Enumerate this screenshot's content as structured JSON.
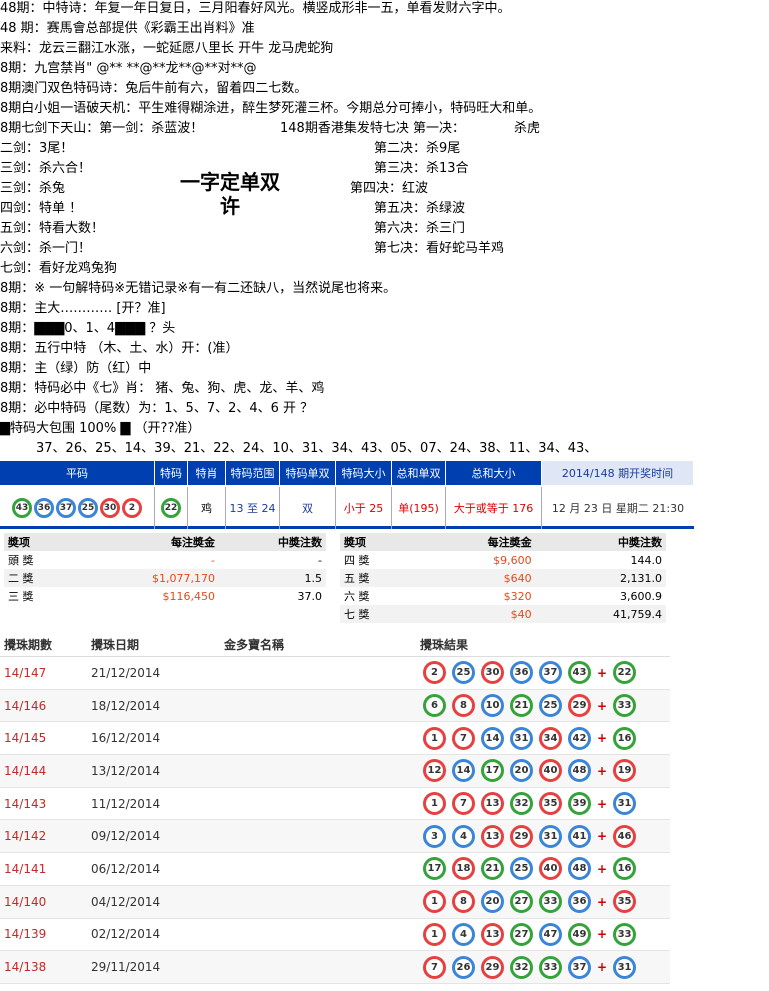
{
  "lines": [
    "48期：中特诗：年复一年日复日，三月阳春好风光。横竖成形非一五，单看发财六字中。",
    "48 期：赛馬會总部提供《彩霸王出肖料》准",
    "来料：龙云三翻江水涨，一蛇延愿八里长 开牛 龙马虎蛇狗",
    "8期：九宫禁肖\" @** **@**龙**@**对**@",
    "8期澳门双色特码诗：兔后牛前有六，留着四二七数。",
    "8期白小姐一语破天机：平生难得糊涂进，醉生梦死灌三杯。今期总分可捧小，特码旺大和单。",
    "8期七剑下天山：第一剑：杀蓝波！",
    "二剑：3尾！",
    "三剑：杀六合！",
    "三剑：杀兔",
    "四剑：特单 ！",
    "五剑：特看大数！",
    "六剑：杀一门！",
    "七剑：看好龙鸡兔狗",
    "8期：※ 一句解特码※无错记录※有一有二还缺八，当然说尾也将来。",
    "8期：主大………… [开？准]",
    "8期：▇▇▇0、1、4▇▇▇ ？头",
    "8期：五行中特 （木、土、水）开：(准）",
    "8期：主（绿）防（红）中",
    "8期：特码必中《七》肖： 猪、兔、狗、虎、龙、羊、鸡",
    "8期：必中特码（尾数）为：1、5、7、2、4、6 开 ？",
    "▇特码大包围 100% ▇ （开??准）",
    "37、26、25、14、39、21、22、24、10、31、34、43、05、07、24、38、11、34、43、"
  ],
  "right_title": "148期香港集发特七决 第一决：",
  "right_first": "杀虎",
  "right_lines": [
    "第二决：杀9尾",
    "第三决：杀13合",
    "第四决：红波",
    "第五决：杀绿波",
    "第六决：杀三门",
    "第七决：看好蛇马羊鸡"
  ],
  "big_text": [
    "一字定单双",
    "许"
  ],
  "bar": {
    "pm": "平码",
    "tx": "特码",
    "ts": "特肖",
    "range": "特码范围",
    "ds": "特码单双",
    "dx": "特码大小",
    "hds": "总和单双",
    "hdx": "总和大小",
    "time": "2014/148 期开奖时间"
  },
  "vals": {
    "balls": [
      "43",
      "36",
      "37",
      "25",
      "30",
      "2"
    ],
    "special": "22",
    "sx": "鸡",
    "range": "13 至 24",
    "ds": "双",
    "dx": "小于 25",
    "hds": "单(195)",
    "hdx": "大于或等于 176",
    "date": "12 月 23 日 星期二 21:30"
  },
  "prize_head": {
    "a": "奬项",
    "b": "每注奬金",
    "c": "中奬注数"
  },
  "prize_left": [
    [
      "頭 獎",
      "-",
      "-"
    ],
    [
      "二 獎",
      "$1,077,170",
      "1.5"
    ],
    [
      "三 獎",
      "$116,450",
      "37.0"
    ]
  ],
  "prize_right": [
    [
      "四 獎",
      "$9,600",
      "144.0"
    ],
    [
      "五 獎",
      "$640",
      "2,131.0"
    ],
    [
      "六 獎",
      "$320",
      "3,600.9"
    ],
    [
      "七 獎",
      "$40",
      "41,759.4"
    ]
  ],
  "draw_head": {
    "no": "攪珠期數",
    "date": "攪珠日期",
    "name": "金多寶名稱",
    "res": "攪珠結果"
  },
  "draws": [
    {
      "no": "14/147",
      "date": "21/12/2014",
      "b": [
        "2",
        "25",
        "30",
        "36",
        "37",
        "43"
      ],
      "s": "22"
    },
    {
      "no": "14/146",
      "date": "18/12/2014",
      "b": [
        "6",
        "8",
        "10",
        "21",
        "25",
        "29"
      ],
      "s": "33"
    },
    {
      "no": "14/145",
      "date": "16/12/2014",
      "b": [
        "1",
        "7",
        "14",
        "31",
        "34",
        "42"
      ],
      "s": "16"
    },
    {
      "no": "14/144",
      "date": "13/12/2014",
      "b": [
        "12",
        "14",
        "17",
        "20",
        "40",
        "48"
      ],
      "s": "19"
    },
    {
      "no": "14/143",
      "date": "11/12/2014",
      "b": [
        "1",
        "7",
        "13",
        "32",
        "35",
        "39"
      ],
      "s": "31"
    },
    {
      "no": "14/142",
      "date": "09/12/2014",
      "b": [
        "3",
        "4",
        "13",
        "29",
        "31",
        "41"
      ],
      "s": "46"
    },
    {
      "no": "14/141",
      "date": "06/12/2014",
      "b": [
        "17",
        "18",
        "21",
        "25",
        "40",
        "48"
      ],
      "s": "16"
    },
    {
      "no": "14/140",
      "date": "04/12/2014",
      "b": [
        "1",
        "8",
        "20",
        "27",
        "33",
        "36"
      ],
      "s": "35"
    },
    {
      "no": "14/139",
      "date": "02/12/2014",
      "b": [
        "1",
        "4",
        "13",
        "27",
        "47",
        "49"
      ],
      "s": "33"
    },
    {
      "no": "14/138",
      "date": "29/11/2014",
      "b": [
        "7",
        "26",
        "29",
        "32",
        "33",
        "37"
      ],
      "s": "31"
    }
  ],
  "colors": {
    "red": "#e64040",
    "blue": "#3a85d8",
    "green": "#33a33a",
    "bar": "#003fb0"
  }
}
